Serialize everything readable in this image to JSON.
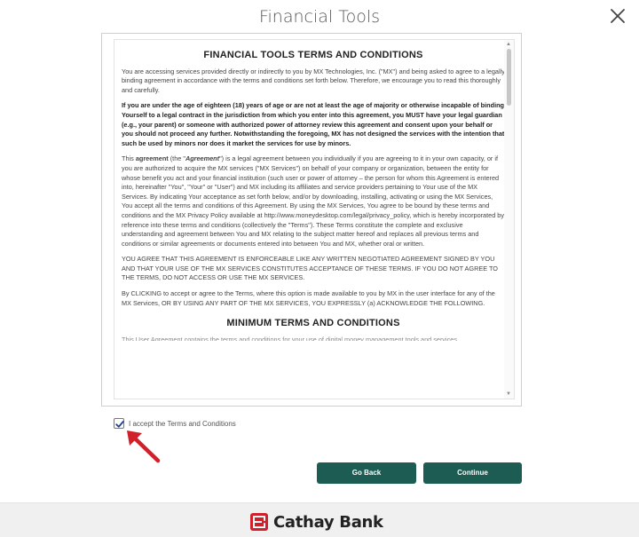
{
  "header": {
    "title": "Financial Tools",
    "close_icon": "close-icon"
  },
  "terms": {
    "heading": "FINANCIAL TOOLS TERMS AND CONDITIONS",
    "paragraphs": [
      {
        "text": "You are accessing services provided directly or indirectly to you by MX Technologies, Inc. (\"MX\") and being asked to agree to a legally binding agreement in accordance with the terms and conditions set forth below. Therefore, we encourage you to read this thoroughly and carefully.",
        "bold": false
      },
      {
        "text": "If you are under the age of eighteen (18) years of age or are not at least the age of majority or otherwise incapable of binding Yourself to a legal contract in the jurisdiction from which you enter into this agreement, you MUST have your legal guardian (e.g., your parent) or someone with authorized power of attorney review this agreement and consent upon your behalf or you should not proceed any further. Notwithstanding the foregoing, MX has not designed the services with the intention that such be used by minors nor does it market the services for use by minors.",
        "bold": true
      }
    ],
    "agreement_p_pre": "This ",
    "agreement_p_strong": "agreement",
    "agreement_p_mid": " (the \"",
    "agreement_p_em": "Agreement",
    "agreement_p_post": "\") is a legal agreement between you individually if you are agreeing to it in your own capacity, or if you are authorized to acquire the MX services (\"MX Services\") on behalf of your company or organization, between the entity for whose benefit you act and your financial institution (such user or power of attorney – the person for whom this Agreement is entered into, hereinafter \"You\", \"Your\" or \"User\") and MX including its affiliates and service providers pertaining to Your use of the MX Services. By indicating Your acceptance as set forth below, and/or by downloading, installing, activating or using the MX Services, You accept all the terms and conditions of this Agreement. By using the MX Services, You agree to be bound by these terms and conditions and the MX Privacy Policy available at http://www.moneydesktop.com/legal/privacy_policy, which is hereby incorporated by reference into these terms and conditions (collectively the \"Terms\"). These Terms constitute the complete and exclusive understanding and agreement between You and MX relating to the subject matter hereof and replaces all previous terms and conditions or similar agreements or documents entered into between You and MX, whether oral or written.",
    "paragraph_enforceable": "YOU AGREE THAT THIS AGREEMENT IS ENFORCEABLE LIKE ANY WRITTEN NEGOTIATED AGREEMENT SIGNED BY YOU AND THAT YOUR USE OF THE MX SERVICES CONSTITUTES ACCEPTANCE OF THESE TERMS. IF YOU DO NOT AGREE TO THE TERMS, DO NOT ACCESS OR USE THE MX SERVICES.",
    "paragraph_clicking": "By CLICKING to accept or agree to the Terms, where this option is made available to you by MX in the user interface for any of the MX Services, OR BY USING ANY PART OF THE MX SERVICES, YOU EXPRESSLY (a) ACKNOWLEDGE THE FOLLOWING.",
    "subheading": "MINIMUM TERMS AND CONDITIONS",
    "cut_line": "This User Agreement contains the terms and conditions for your use of digital money management tools and services"
  },
  "accept": {
    "label": "I accept the Terms and Conditions",
    "checked": true
  },
  "buttons": {
    "go_back": "Go Back",
    "continue": "Continue"
  },
  "footer": {
    "brand": "Cathay Bank"
  },
  "colors": {
    "button": "#1d5c53",
    "arrow": "#d0202a",
    "logo": "#d0202a"
  }
}
